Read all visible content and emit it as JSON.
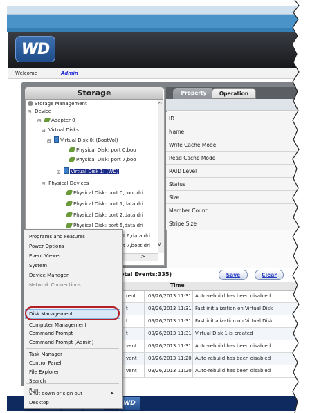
{
  "header": {
    "logo_text": "WD",
    "welcome_label": "Welcome",
    "user": "Admin"
  },
  "storage": {
    "title": "Storage",
    "tree": [
      {
        "label": "Storage Management",
        "icon": "storage-icon"
      },
      {
        "label": "Device",
        "icon": "device-icon"
      },
      {
        "label": "Adapter 0",
        "icon": "adapter-icon"
      },
      {
        "label": "Virtual Disks",
        "icon": "folder-icon"
      },
      {
        "label": "Virtual Disk 0: (BootVol)",
        "icon": "virtual-disk-icon"
      },
      {
        "label": "Physical Disk: port 0,boo",
        "icon": "physical-disk-icon"
      },
      {
        "label": "Physical Disk: port 7,boo",
        "icon": "physical-disk-icon"
      },
      {
        "label": "Virtual Disk 1: (WD)",
        "icon": "virtual-disk-icon",
        "selected": true
      },
      {
        "label": "Physical Devices",
        "icon": "folder-icon"
      },
      {
        "label": "Physical Disk: port 0,boot dri",
        "icon": "physical-disk-icon"
      },
      {
        "label": "Physical Disk: port 1,data dri",
        "icon": "physical-disk-icon"
      },
      {
        "label": "Physical Disk: port 2,data dri",
        "icon": "physical-disk-icon"
      },
      {
        "label": "Physical Disk: port 5,data dri",
        "icon": "physical-disk-icon"
      },
      {
        "label": "t 6,data dri",
        "icon": "physical-disk-icon"
      },
      {
        "label": "t 7,boot dri",
        "icon": "physical-disk-icon"
      }
    ]
  },
  "tabs": {
    "property": "Property",
    "operation": "Operation"
  },
  "properties": [
    "ID",
    "Name",
    "Write Cache Mode",
    "Read Cache Mode",
    "RAID Level",
    "Status",
    "Size",
    "Member Count",
    "Stripe Size"
  ],
  "events": {
    "title": "otal Events:335)",
    "save": "Save",
    "clear": "Clear",
    "col_time": "Time",
    "rows": [
      {
        "ev": "rent",
        "time": "09/26/2013 11:31",
        "desc": "Auto-rebuild has been disabled"
      },
      {
        "ev": "t",
        "time": "09/26/2013 11:31",
        "desc": "Fast initialization on Virtual Disk"
      },
      {
        "ev": "t",
        "time": "09/26/2013 11:31",
        "desc": "Fast initialization on Virtual Disk"
      },
      {
        "ev": "t",
        "time": "09/26/2013 11:31",
        "desc": "Virtual Disk 1 is created"
      },
      {
        "ev": "vent",
        "time": "09/26/2013 11:31",
        "desc": "Auto-rebuild has been disabled"
      },
      {
        "ev": "vent",
        "time": "09/26/2013 11:20",
        "desc": "Auto-rebuild has been disabled"
      },
      {
        "ev": "vent",
        "time": "09/26/2013 11:20",
        "desc": "Auto-rebuild has been disabled"
      }
    ]
  },
  "menu": {
    "items": [
      "Programs and Features",
      "Power Options",
      "Event Viewer",
      "System",
      "Device Manager",
      "Network Connections",
      "Disk Management",
      "Computer Management",
      "Command Prompt",
      "Command Prompt (Admin)",
      "Task Manager",
      "Control Panel",
      "File Explorer",
      "Search",
      "Run",
      "Shut down or sign out",
      "Desktop"
    ],
    "highlighted": "Disk Management"
  },
  "taskbar": {
    "wd_label": "WD"
  },
  "colors": {
    "highlight_oval": "#b41f26",
    "header_blue": "#4a93c9",
    "selection": "#1b2b8a"
  }
}
